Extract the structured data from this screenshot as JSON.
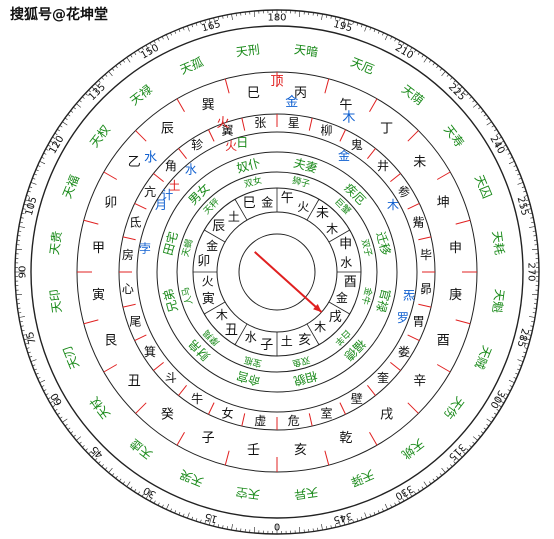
{
  "watermark": "搜狐号@花坤堂",
  "colors": {
    "ring": "#222222",
    "red": "#e02020",
    "blue": "#1060d0",
    "green": "#1a8a1a",
    "black": "#111111",
    "navy": "#1a2a80"
  },
  "degree_labels": [
    "0",
    "15",
    "30",
    "45",
    "60",
    "75",
    "90",
    "105",
    "120",
    "135",
    "150",
    "165",
    "180",
    "195",
    "210",
    "225",
    "240",
    "255",
    "270",
    "285",
    "300",
    "315",
    "330",
    "345"
  ],
  "branches": [
    "子",
    "丑",
    "寅",
    "卯",
    "辰",
    "巳",
    "午",
    "未",
    "申",
    "酉",
    "戌",
    "亥"
  ],
  "stems_ring": [
    "壬",
    "子",
    "癸",
    "丑",
    "艮",
    "寅",
    "甲",
    "卯",
    "乙",
    "辰",
    "巽",
    "巳",
    "丙",
    "午",
    "丁",
    "未",
    "坤",
    "申",
    "庚",
    "酉",
    "辛",
    "戌",
    "乾",
    "亥"
  ],
  "mansions": [
    "虚",
    "女",
    "牛",
    "斗",
    "箕",
    "尾",
    "心",
    "房",
    "氐",
    "亢",
    "角",
    "轸",
    "翼",
    "张",
    "星",
    "柳",
    "鬼",
    "井",
    "参",
    "觜",
    "毕",
    "昴",
    "胃",
    "娄",
    "奎",
    "壁",
    "室",
    "危"
  ],
  "palace_names": [
    "宝瓶",
    "摩羯",
    "人马",
    "天蝎",
    "天秤",
    "双女",
    "狮子",
    "巨蟹",
    "双子",
    "金牛",
    "白羊",
    "双鱼"
  ],
  "outer_stars": [
    "天空",
    "天哭",
    "天虚",
    "天杖",
    "天刃",
    "天印",
    "天贵",
    "天福",
    "天权",
    "天禄",
    "天孤",
    "天刑",
    "天暗",
    "天厄",
    "天荫",
    "天寿",
    "天囚",
    "天耗",
    "天魁",
    "天贼",
    "天伤",
    "天姚",
    "天驿",
    "天异"
  ],
  "planets": [
    {
      "name": "火",
      "color": "red"
    },
    {
      "name": "土",
      "color": "red"
    },
    {
      "name": "金",
      "color": "blue"
    },
    {
      "name": "木",
      "color": "blue"
    },
    {
      "name": "水",
      "color": "blue"
    },
    {
      "name": "月",
      "color": "blue"
    },
    {
      "name": "孛",
      "color": "blue"
    },
    {
      "name": "计",
      "color": "blue"
    },
    {
      "name": "罗",
      "color": "blue"
    },
    {
      "name": "炁",
      "color": "blue"
    },
    {
      "name": "日",
      "color": "green"
    }
  ],
  "inner_elements": [
    "水",
    "木",
    "火",
    "金",
    "土",
    "金",
    "火",
    "木",
    "水",
    "金",
    "木",
    "土"
  ],
  "palaces": [
    "命宫",
    "财帛",
    "兄弟",
    "田宅",
    "男女",
    "奴仆",
    "夫妻",
    "疾厄",
    "迁移",
    "官禄",
    "福德",
    "相貌"
  ],
  "top_markers": {
    "top": "顶",
    "fire": "火",
    "metal": "金",
    "wood": "木",
    "water": "水"
  }
}
